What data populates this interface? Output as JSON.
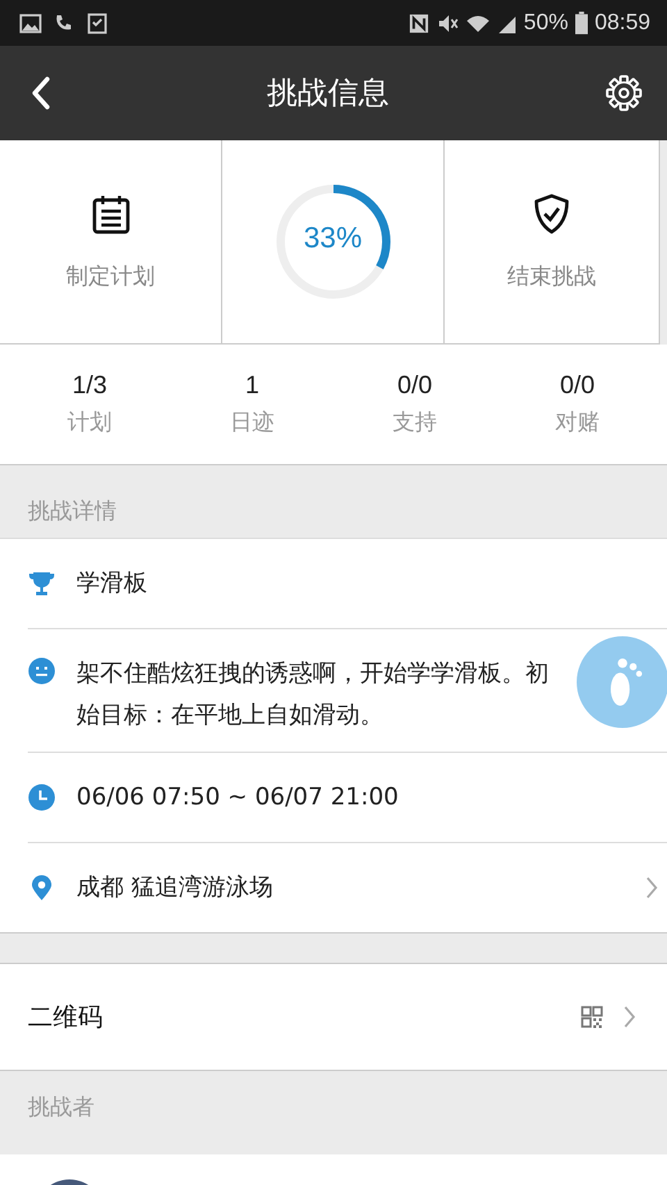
{
  "status_bar": {
    "battery_text": "50%",
    "time": "08:59"
  },
  "header": {
    "title": "挑战信息"
  },
  "actions": [
    {
      "kind": "plan",
      "label": "制定计划"
    },
    {
      "kind": "progress",
      "level": 0.33,
      "label": "33%"
    },
    {
      "kind": "finish",
      "label": "结束挑战"
    }
  ],
  "stats": [
    {
      "value": "1/3",
      "label": "计划"
    },
    {
      "value": "1",
      "label": "日迹"
    },
    {
      "value": "0/0",
      "label": "支持"
    },
    {
      "value": "0/0",
      "label": "对赌"
    }
  ],
  "details_section": {
    "title": "挑战详情"
  },
  "details": [
    {
      "kind": "name",
      "text": "学滑板"
    },
    {
      "kind": "description",
      "text": "架不住酷炫狂拽的诱惑啊，开始学学滑板。初始目标：在平地上自如滑动。"
    },
    {
      "kind": "time",
      "text": "06/06 07:50 ~ 06/07 21:00"
    },
    {
      "kind": "location",
      "text": "成都 猛追湾游泳场"
    }
  ],
  "qr_row": {
    "label": "二维码"
  },
  "challengers_section": {
    "title": "挑战者"
  }
}
